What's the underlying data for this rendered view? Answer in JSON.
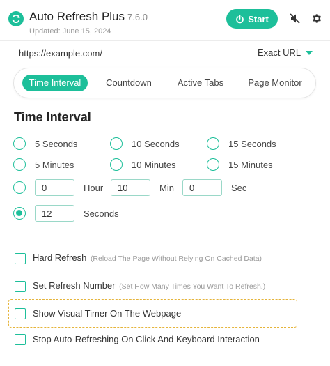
{
  "header": {
    "app_name": "Auto Refresh Plus",
    "version": "7.6.0",
    "updated": "Updated: June 15, 2024",
    "start_label": "Start",
    "logo_icon": "refresh-icon",
    "mute_icon": "mute-icon",
    "settings_icon": "gear-icon"
  },
  "url_bar": {
    "url": "https://example.com/",
    "match_mode": "Exact URL"
  },
  "tabs": [
    {
      "label": "Time Interval",
      "active": true
    },
    {
      "label": "Countdown",
      "active": false
    },
    {
      "label": "Active Tabs",
      "active": false
    },
    {
      "label": "Page Monitor",
      "active": false
    }
  ],
  "section_title": "Time Interval",
  "presets": [
    {
      "label": "5 Seconds"
    },
    {
      "label": "10 Seconds"
    },
    {
      "label": "15 Seconds"
    },
    {
      "label": "5 Minutes"
    },
    {
      "label": "10 Minutes"
    },
    {
      "label": "15 Minutes"
    }
  ],
  "custom_hms": {
    "hour_value": "0",
    "hour_unit": "Hour",
    "min_value": "10",
    "min_unit": "Min",
    "sec_value": "0",
    "sec_unit": "Sec"
  },
  "custom_seconds": {
    "value": "12",
    "unit": "Seconds",
    "selected": true
  },
  "options": [
    {
      "label": "Hard Refresh",
      "hint": "(Reload The Page Without Relying On Cached Data)"
    },
    {
      "label": "Set Refresh Number",
      "hint": "(Set How Many Times You Want To Refresh.)"
    },
    {
      "label": "Show Visual Timer On The Webpage",
      "hint": ""
    },
    {
      "label": "Stop Auto-Refreshing On Click And Keyboard Interaction",
      "hint": ""
    }
  ],
  "colors": {
    "accent": "#1dbf9a",
    "highlight": "#f7f2b6",
    "dashed_border": "#e5b43a"
  }
}
